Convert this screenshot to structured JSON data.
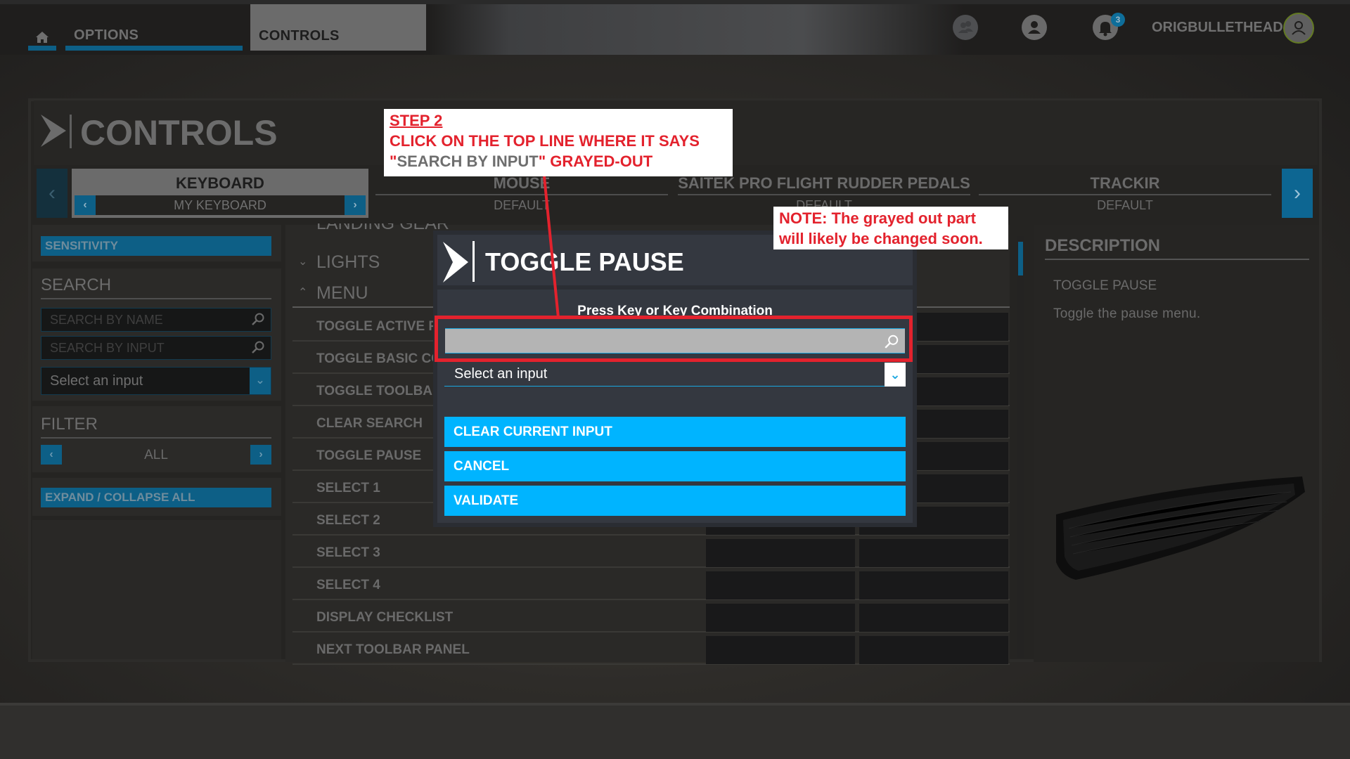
{
  "topbar": {
    "nav": [
      {
        "id": "home",
        "icon": "home-icon",
        "label": ""
      },
      {
        "id": "options",
        "label": "OPTIONS"
      },
      {
        "id": "controls",
        "label": "CONTROLS",
        "active": true
      }
    ],
    "icons": [
      "friends-icon",
      "profile-icon",
      "bell-icon"
    ],
    "notification_count": "3",
    "username": "ORIGBULLETHEAD",
    "avatar_icon": "user-avatar-icon"
  },
  "page": {
    "title": "CONTROLS"
  },
  "devices": {
    "tabs": [
      {
        "name": "KEYBOARD",
        "profile": "MY KEYBOARD",
        "active": true
      },
      {
        "name": "MOUSE",
        "profile": "DEFAULT"
      },
      {
        "name": "SAITEK PRO FLIGHT RUDDER PEDALS",
        "profile": "DEFAULT"
      },
      {
        "name": "TRACKIR",
        "profile": "DEFAULT"
      }
    ]
  },
  "sidebar": {
    "sensitivity_label": "SENSITIVITY",
    "search_title": "SEARCH",
    "search_by_name_placeholder": "SEARCH BY NAME",
    "search_by_input_placeholder": "SEARCH BY INPUT",
    "select_input_label": "Select an input",
    "filter_title": "FILTER",
    "filter_value": "ALL",
    "expand_collapse_label": "EXPAND / COLLAPSE ALL"
  },
  "list": {
    "partial_category": "LANDING GEAR",
    "categories": [
      {
        "label": "LIGHTS",
        "expanded": false
      },
      {
        "label": "MENU",
        "expanded": true
      }
    ],
    "rows": [
      "TOGGLE ACTIVE PAUSE",
      "TOGGLE BASIC CONTROL",
      "TOGGLE TOOLBAR",
      "CLEAR SEARCH",
      "TOGGLE PAUSE",
      "SELECT 1",
      "SELECT 2",
      "SELECT 3",
      "SELECT 4",
      "DISPLAY CHECKLIST",
      "NEXT TOOLBAR PANEL"
    ]
  },
  "description": {
    "title": "DESCRIPTION",
    "action_name": "TOGGLE PAUSE",
    "text": "Toggle the pause menu."
  },
  "modal": {
    "title": "TOGGLE PAUSE",
    "prompt": "Press Key or Key Combination",
    "key_input_value": "",
    "select_label": "Select an input",
    "buttons": {
      "clear": "CLEAR CURRENT INPUT",
      "cancel": "CANCEL",
      "validate": "VALIDATE"
    }
  },
  "annotations": {
    "step_title": "STEP 2",
    "step_line1": "CLICK ON THE TOP LINE WHERE IT SAYS",
    "step_line2_open_quote": "\"",
    "step_line2_gray": "SEARCH BY INPUT",
    "step_line2_close": "\" GRAYED-OUT",
    "note_line1": "NOTE:  The grayed out part",
    "note_line2": "will likely be changed soon.",
    "color": "#e3222d"
  },
  "colors": {
    "accent_blue": "#00b4ff",
    "dim_blue": "#0d5f86",
    "annotation_red": "#e3222d"
  }
}
